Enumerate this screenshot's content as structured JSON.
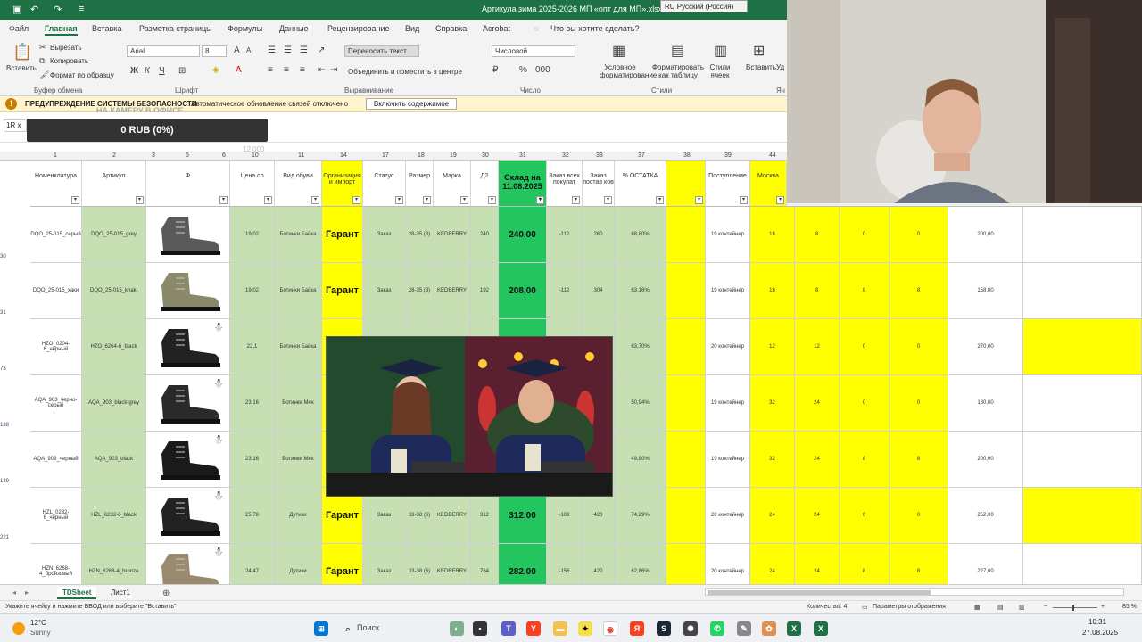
{
  "app": {
    "title": "Артикула зима 2025-2026 МП «опт для МП».xlsx",
    "language_dropdown": "RU Русский (Россия)",
    "accent": "#1e7145"
  },
  "menu": {
    "tabs": [
      "Файл",
      "Главная",
      "Вставка",
      "Разметка страницы",
      "Формулы",
      "Данные",
      "Рецензирование",
      "Вид",
      "Справка",
      "Acrobat"
    ],
    "active": "Главная",
    "tell_me": "Что вы хотите сделать?"
  },
  "ribbon": {
    "paste": "Вставить",
    "cut": "Вырезать",
    "copy": "Копировать",
    "format_painter": "Формат по образцу",
    "group_clipboard": "Буфер обмена",
    "font_name": "Arial",
    "font_size": "8",
    "group_font": "Шрифт",
    "wrap_text": "Переносить текст",
    "merge_center": "Объединить и поместить в центре",
    "group_alignment": "Выравнивание",
    "number_format": "Числовой",
    "group_number": "Число",
    "conditional_formatting": "Условное форматирование",
    "format_as_table": "Форматировать как таблицу",
    "cell_styles": "Стили ячеек",
    "group_styles": "Стили",
    "insert": "Вставить",
    "insert2": "Уд",
    "group_cells": "Яч"
  },
  "security": {
    "title": "ПРЕДУПРЕЖДЕНИЕ СИСТЕМЫ БЕЗОПАСНОСТИ",
    "message": "Автоматическое обновление связей отключено",
    "button": "Включить содержимое",
    "overlay": "НА КАМЕРУ В ОФИСЕ"
  },
  "formula": {
    "namebox": "1R x"
  },
  "overlay": {
    "rub": "0 RUB (0%)",
    "ghost": "12 000"
  },
  "col_numbers": [
    "1",
    "2",
    "3",
    "5",
    "6",
    "10",
    "11",
    "14",
    "17",
    "18",
    "19",
    "30",
    "31",
    "32",
    "33",
    "37",
    "38",
    "39",
    "44"
  ],
  "headers": {
    "nomenclature": "Номенклатура",
    "article": "Артикул",
    "photo": "Ф",
    "price": "Цена со",
    "shoe_type": "Вид обуви",
    "org": "Организация и импорт",
    "status": "Статус",
    "size": "Размер",
    "brand": "Марка",
    "stock": "Склад на 11.08.2025",
    "order_all": "Заказ всех покупат",
    "order_suppl": "Заказ постав ков",
    "pct": "% ОСТАТКА",
    "arrival": "Поступление",
    "moscow": "Москва",
    "sub": "Д2"
  },
  "rows": [
    {
      "num": "30",
      "nomen": "DQO_25-015_серый",
      "article": "DQO_25-015_grey",
      "price": "19,02",
      "type": "Ботинки Байка",
      "org": "Гарант",
      "status": "Заказ",
      "size": "28-35 (8)",
      "brand": "KEDBERRY",
      "qty": "240",
      "stock": "240,00",
      "order": "-112",
      "suppl": "260",
      "pct": "68,80%",
      "arrival": "19 контейнер",
      "m1": "16",
      "m2": "8",
      "m3": "0",
      "m4": "0",
      "total": "200,00"
    },
    {
      "num": "31",
      "nomen": "DQO_25-015_хаки",
      "article": "DQO_25-015_khaki",
      "price": "19,02",
      "type": "Ботинки Байка",
      "org": "Гарант",
      "status": "Заказ",
      "size": "28-35 (8)",
      "brand": "KEDBERRY",
      "qty": "192",
      "stock": "208,00",
      "order": "-112",
      "suppl": "304",
      "pct": "63,16%",
      "arrival": "19 контейнер",
      "m1": "16",
      "m2": "8",
      "m3": "8",
      "m4": "8",
      "total": "158,00"
    },
    {
      "num": "73",
      "nomen": "HZO_0204-6_черный",
      "article": "HZO_6264-6_black",
      "price": "22,1",
      "type": "Ботинки Байка",
      "org": "",
      "status": "",
      "size": "",
      "brand": "",
      "qty": "",
      "stock": "",
      "order": "",
      "suppl": "",
      "pct": "63,70%",
      "arrival": "20 контейнер",
      "m1": "12",
      "m2": "12",
      "m3": "0",
      "m4": "0",
      "total": "270,00"
    },
    {
      "num": "138",
      "nomen": "AQA_903_черно-серый",
      "article": "AQA_903_black-grey",
      "price": "23,16",
      "type": "Ботинки Мех",
      "org": "",
      "status": "",
      "size": "",
      "brand": "",
      "qty": "",
      "stock": "",
      "order": "",
      "suppl": "",
      "pct": "50,94%",
      "arrival": "19 контейнер",
      "m1": "32",
      "m2": "24",
      "m3": "0",
      "m4": "0",
      "total": "180,00"
    },
    {
      "num": "139",
      "nomen": "AQA_903_черный",
      "article": "AQA_903_black",
      "price": "23,16",
      "type": "Ботинки Мех",
      "org": "",
      "status": "",
      "size": "",
      "brand": "",
      "qty": "",
      "stock": "",
      "order": "",
      "suppl": "",
      "pct": "49,80%",
      "arrival": "19 контейнер",
      "m1": "32",
      "m2": "24",
      "m3": "8",
      "m4": "8",
      "total": "200,00"
    },
    {
      "num": "221",
      "nomen": "HZL_0232-6_черный",
      "article": "HZL_6232-6_black",
      "price": "25,78",
      "type": "Дутики",
      "org": "Гарант",
      "status": "Заказ",
      "size": "33-38 (6)",
      "brand": "KEDBERRY",
      "qty": "312",
      "stock": "312,00",
      "order": "-108",
      "suppl": "420",
      "pct": "74,29%",
      "arrival": "20 контейнер",
      "m1": "24",
      "m2": "24",
      "m3": "0",
      "m4": "0",
      "total": "252,00"
    },
    {
      "num": "",
      "nomen": "HZN_6268-4_бронзовый",
      "article": "HZN_6268-4_bronze",
      "price": "24,47",
      "type": "Дутики",
      "org": "Гарант",
      "status": "Заказ",
      "size": "33-38 (6)",
      "brand": "KEDBERRY",
      "qty": "764",
      "stock": "282,00",
      "order": "-156",
      "suppl": "420",
      "pct": "62,86%",
      "arrival": "20 контейнер",
      "m1": "24",
      "m2": "24",
      "m3": "8",
      "m4": "8",
      "total": "227,00"
    }
  ],
  "sheets": [
    "TDSheet",
    "Лист1"
  ],
  "active_sheet": "TDSheet",
  "status": {
    "hint": "Укажите ячейку и нажмите ВВОД или выберите \"Вставить\"",
    "count": "Количество: 4",
    "display": "Параметры отображения",
    "zoom": "85 %"
  },
  "taskbar": {
    "temp": "12°C",
    "weather": "Sunny",
    "search": "Поиск",
    "time": "10:31",
    "date": "27.08.2025"
  }
}
